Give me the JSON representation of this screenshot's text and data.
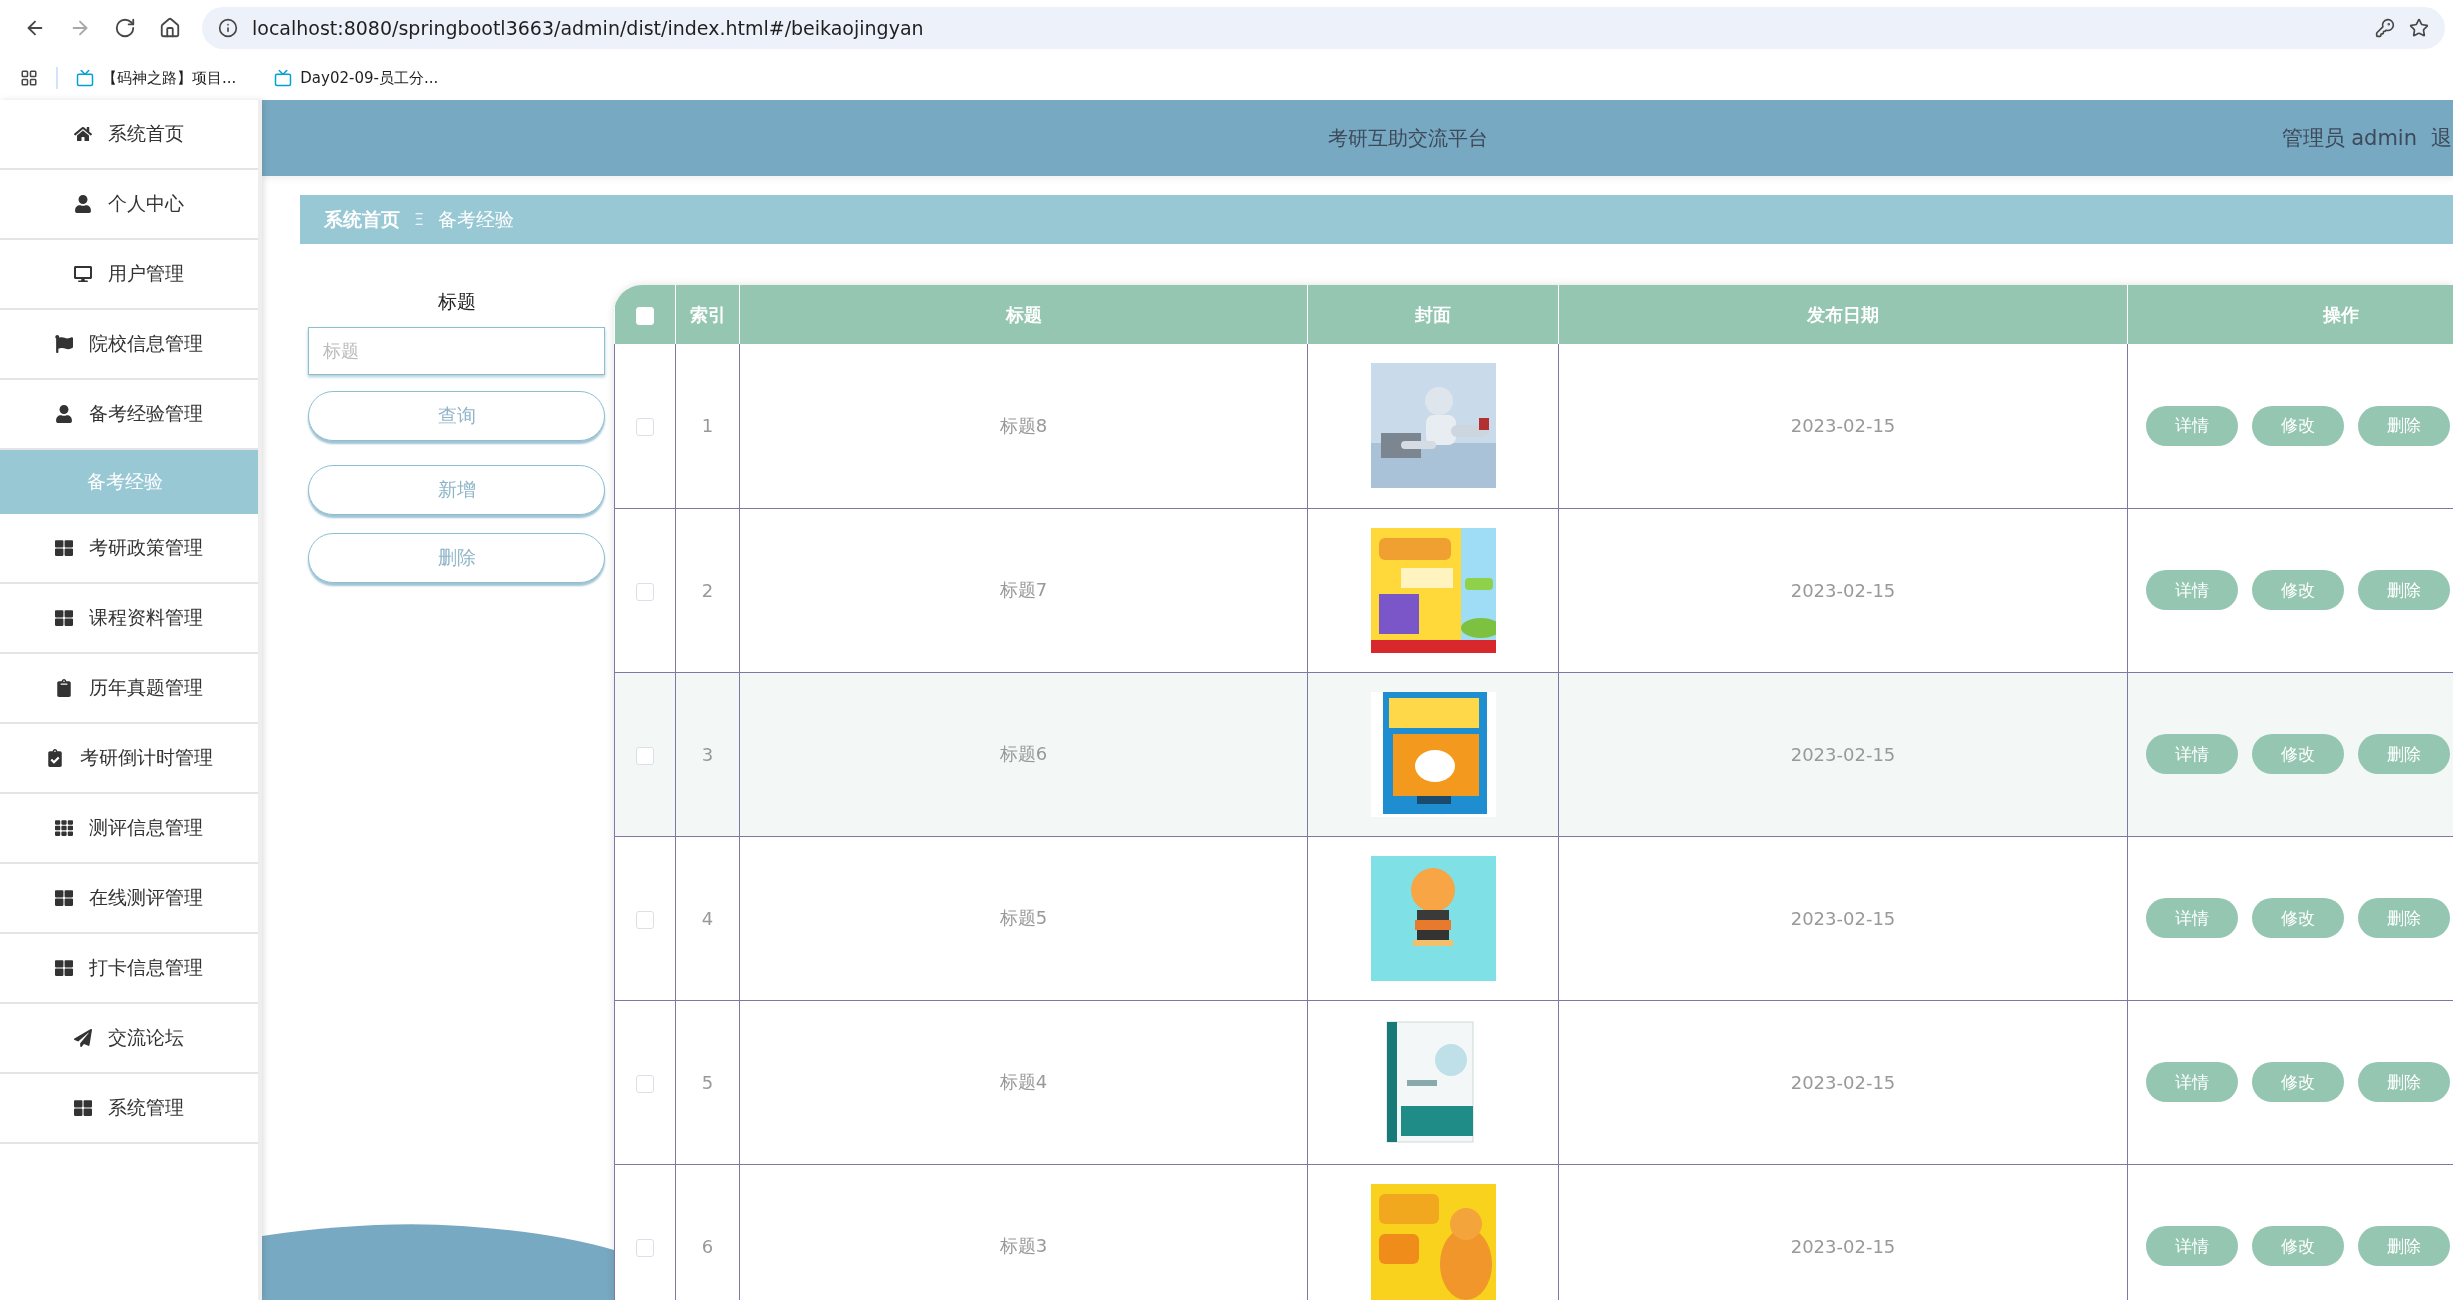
{
  "browser": {
    "nav_buttons": [
      {
        "kind": "back",
        "disabled": false
      },
      {
        "kind": "forward",
        "disabled": true
      },
      {
        "kind": "reload",
        "disabled": false
      },
      {
        "kind": "home",
        "disabled": false
      }
    ],
    "url": "localhost:8080/springbootl3663/admin/dist/index.html#/beikaojingyan",
    "bookmarks": [
      {
        "label": "【码神之路】项目..."
      },
      {
        "label": "Day02-09-员工分..."
      }
    ]
  },
  "sidebar": {
    "items": [
      {
        "label": "系统首页",
        "kind": "menu",
        "selected": false
      },
      {
        "label": "个人中心",
        "kind": "menu",
        "selected": false
      },
      {
        "label": "用户管理",
        "kind": "menu",
        "selected": false
      },
      {
        "label": "院校信息管理",
        "kind": "menu",
        "selected": false
      },
      {
        "label": "备考经验管理",
        "kind": "menu",
        "selected": false
      },
      {
        "label": "备考经验",
        "kind": "submenu",
        "selected": true
      },
      {
        "label": "考研政策管理",
        "kind": "menu",
        "selected": false
      },
      {
        "label": "课程资料管理",
        "kind": "menu",
        "selected": false
      },
      {
        "label": "历年真题管理",
        "kind": "menu",
        "selected": false
      },
      {
        "label": "考研倒计时管理",
        "kind": "menu",
        "selected": false
      },
      {
        "label": "测评信息管理",
        "kind": "menu",
        "selected": false
      },
      {
        "label": "在线测评管理",
        "kind": "menu",
        "selected": false
      },
      {
        "label": "打卡信息管理",
        "kind": "menu",
        "selected": false
      },
      {
        "label": "交流论坛",
        "kind": "menu",
        "selected": false
      },
      {
        "label": "系统管理",
        "kind": "menu",
        "selected": false
      }
    ]
  },
  "header": {
    "title": "考研互助交流平台",
    "user": "管理员 admin",
    "logout": "退"
  },
  "breadcrumb": {
    "items": [
      "系统首页",
      "备考经验"
    ],
    "separator": "Ξ"
  },
  "search": {
    "label": "标题",
    "placeholder": "标题",
    "buttons": [
      "查询",
      "新增",
      "删除"
    ]
  },
  "table": {
    "select_all_checked": false,
    "columns": [
      "索引",
      "标题",
      "封面",
      "发布日期",
      "操作"
    ],
    "rows": [
      {
        "checked": false,
        "highlighted": false,
        "index": "1",
        "title": "标题8",
        "date": "2023-02-15",
        "actions": [
          "详情",
          "修改",
          "删除"
        ]
      },
      {
        "checked": false,
        "highlighted": false,
        "index": "2",
        "title": "标题7",
        "date": "2023-02-15",
        "actions": [
          "详情",
          "修改",
          "删除"
        ]
      },
      {
        "checked": false,
        "highlighted": true,
        "index": "3",
        "title": "标题6",
        "date": "2023-02-15",
        "actions": [
          "详情",
          "修改",
          "删除"
        ]
      },
      {
        "checked": false,
        "highlighted": false,
        "index": "4",
        "title": "标题5",
        "date": "2023-02-15",
        "actions": [
          "详情",
          "修改",
          "删除"
        ]
      },
      {
        "checked": false,
        "highlighted": false,
        "index": "5",
        "title": "标题4",
        "date": "2023-02-15",
        "actions": [
          "详情",
          "修改",
          "删除"
        ]
      },
      {
        "checked": false,
        "highlighted": false,
        "index": "6",
        "title": "标题3",
        "date": "2023-02-15",
        "actions": [
          "详情",
          "修改",
          "删除"
        ]
      }
    ]
  }
}
